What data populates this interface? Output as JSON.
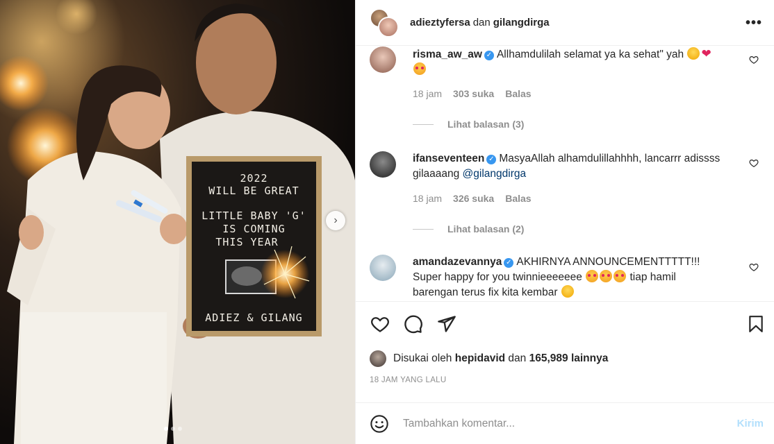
{
  "photo": {
    "board_lines": [
      "2022",
      "WILL BE GREAT",
      "LITTLE BABY 'G'",
      "IS COMING",
      "THIS YEAR",
      "ADIEZ & GILANG"
    ],
    "next_icon": "chevron-right-icon",
    "carousel_total": 3,
    "carousel_active": 1
  },
  "header": {
    "user1": "adieztyfersa",
    "conj": "dan",
    "user2": "gilangdirga",
    "more_icon": "more-horizontal-icon"
  },
  "comments": [
    {
      "user": "risma_aw_aw",
      "text": "Allhamdulilah selamat ya ka sehat\" yah",
      "time": "18 jam",
      "likes": "303 suka",
      "reply": "Balas",
      "view_replies": "Lihat balasan (3)"
    },
    {
      "user": "ifanseventeen",
      "text": "MasyaAllah alhamdulillahhhh, lancarrr adissss gilaaaang",
      "mention": "@gilangdirga",
      "time": "18 jam",
      "likes": "326 suka",
      "reply": "Balas",
      "view_replies": "Lihat balasan (2)"
    },
    {
      "user": "amandazevannya",
      "text1": "AKHIRNYA ANNOUNCEMENTTTTT!!!",
      "text2": "Super happy for you twinnieeeeeee",
      "text3": "tiap hamil",
      "text4": "barengan terus fix kita kembar"
    }
  ],
  "actions": {
    "liked_prefix": "Disukai oleh",
    "liked_user": "hepidavid",
    "liked_mid": "dan",
    "liked_count": "165,989 lainnya",
    "time_ago": "18 JAM YANG LALU"
  },
  "comment_box": {
    "placeholder": "Tambahkan komentar...",
    "post_label": "Kirim"
  },
  "colors": {
    "verified": "#3897f0",
    "post_disabled": "#b2dffc",
    "mention": "#00376b"
  }
}
